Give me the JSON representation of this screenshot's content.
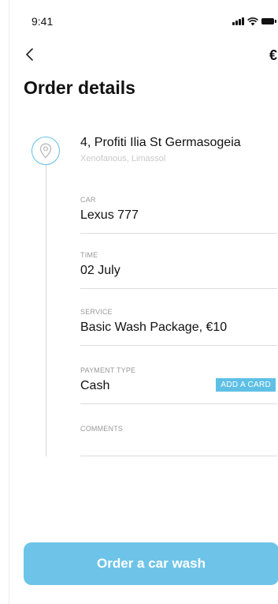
{
  "status_bar": {
    "time": "9:41"
  },
  "nav": {
    "currency_symbol": "€"
  },
  "page": {
    "title": "Order details"
  },
  "address": {
    "line1": "4, Profiti Ilia St Germasogeia",
    "line2": "Xenofanous, Limassol"
  },
  "fields": {
    "car": {
      "label": "CAR",
      "value": "Lexus 777"
    },
    "time": {
      "label": "TIME",
      "value": "02 July"
    },
    "service": {
      "label": "SERVICE",
      "value": "Basic Wash Package, €10"
    },
    "payment": {
      "label": "PAYMENT TYPE",
      "value": "Cash",
      "action_label": "ADD A CARD"
    },
    "comments": {
      "label": "COMMENTS",
      "value": ""
    }
  },
  "actions": {
    "order_label": "Order a car wash"
  },
  "colors": {
    "accent": "#5fc0e6",
    "button": "#6ec4e8"
  }
}
